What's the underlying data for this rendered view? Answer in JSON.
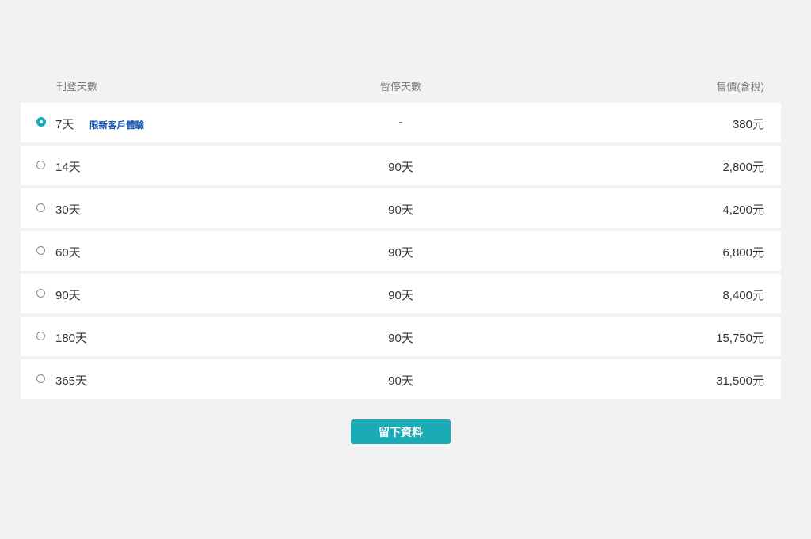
{
  "header": {
    "days_label": "刊登天數",
    "pause_label": "暫停天數",
    "price_label": "售價(含稅)"
  },
  "plans": [
    {
      "days": "7天",
      "badge": "限新客戶體驗",
      "pause": "-",
      "price": "380元",
      "selected": true
    },
    {
      "days": "14天",
      "pause": "90天",
      "price": "2,800元",
      "selected": false
    },
    {
      "days": "30天",
      "pause": "90天",
      "price": "4,200元",
      "selected": false
    },
    {
      "days": "60天",
      "pause": "90天",
      "price": "6,800元",
      "selected": false
    },
    {
      "days": "90天",
      "pause": "90天",
      "price": "8,400元",
      "selected": false
    },
    {
      "days": "180天",
      "pause": "90天",
      "price": "15,750元",
      "selected": false
    },
    {
      "days": "365天",
      "pause": "90天",
      "price": "31,500元",
      "selected": false
    }
  ],
  "submit_label": "留下資料",
  "colors": {
    "accent": "#1aabb6",
    "badge": "#1a56b3",
    "background": "#f2f2f2"
  }
}
